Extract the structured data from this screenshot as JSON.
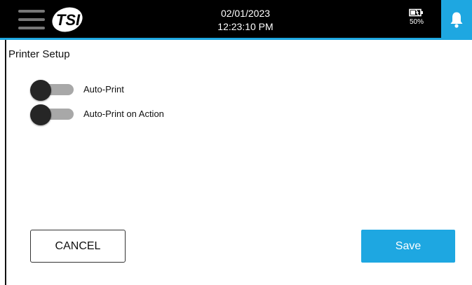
{
  "header": {
    "date": "02/01/2023",
    "time": "12:23:10 PM",
    "battery_percent": "50%",
    "battery_level": 0.5,
    "menu_icon": "hamburger-menu-icon",
    "logo_icon": "tsi-logo",
    "battery_icon": "battery-charging-icon",
    "notification_icon": "bell-icon"
  },
  "page": {
    "title": "Printer Setup"
  },
  "settings": [
    {
      "label": "Auto-Print",
      "enabled": false
    },
    {
      "label": "Auto-Print on Action",
      "enabled": false
    }
  ],
  "footer": {
    "cancel_label": "CANCEL",
    "save_label": "Save"
  },
  "colors": {
    "accent": "#1ea7e1",
    "topbar": "#000000",
    "toggle_track": "#a8a8a8",
    "toggle_knob": "#262626"
  }
}
